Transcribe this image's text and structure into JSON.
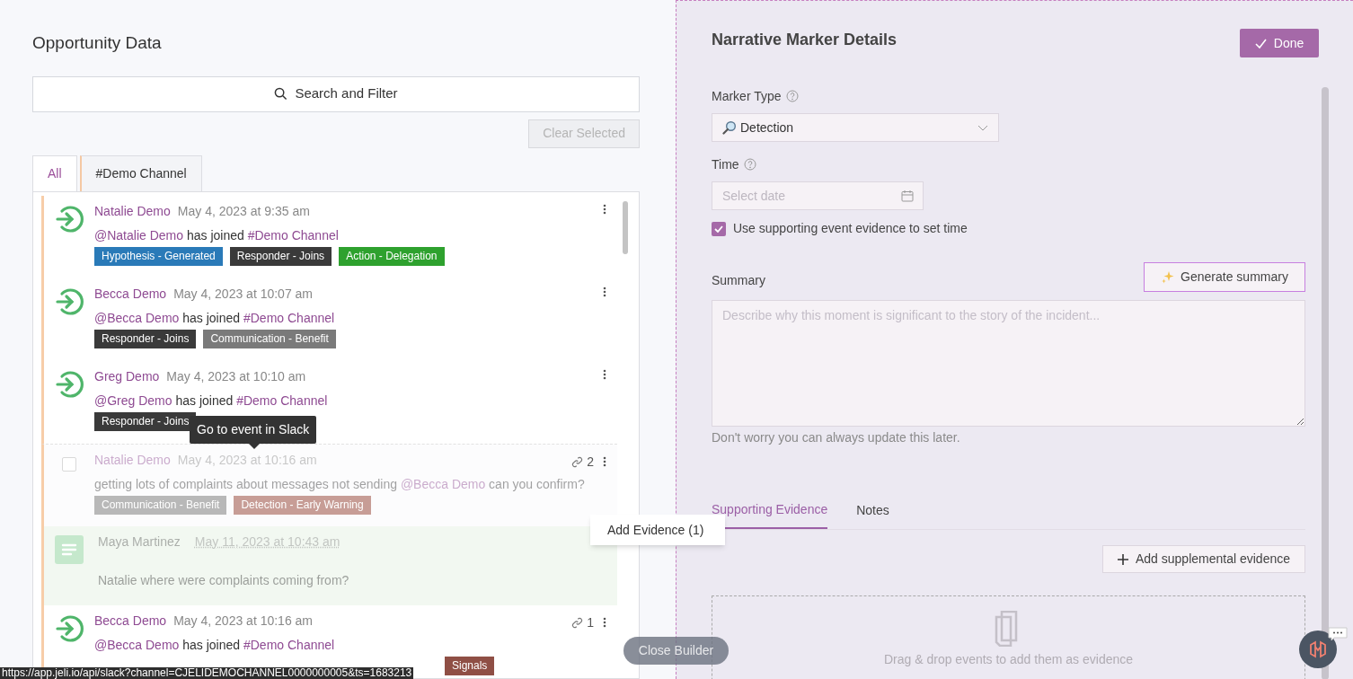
{
  "left": {
    "title": "Opportunity Data",
    "search_button": "Search and Filter",
    "clear_button": {
      "label": "Clear Selected",
      "disabled": true
    },
    "tabs": [
      {
        "label": "All",
        "selected": true
      },
      {
        "label": "#Demo Channel",
        "selected": false
      }
    ],
    "events": [
      {
        "kind": "join",
        "dimmed": false,
        "author": "Natalie Demo",
        "time": "May 4, 2023 at 9:35 am",
        "segments": [
          {
            "text": "@Natalie Demo",
            "mention": true
          },
          {
            "text": " has joined ",
            "mention": false
          },
          {
            "text": "#Demo Channel",
            "mention": true
          }
        ],
        "tags": [
          {
            "label": "Hypothesis - Generated",
            "color": "#2a7ab8"
          },
          {
            "label": "Responder - Joins",
            "color": "#3a3a3a"
          },
          {
            "label": "Action - Delegation",
            "color": "#2ea12e"
          }
        ]
      },
      {
        "kind": "join",
        "dimmed": false,
        "author": "Becca Demo",
        "time": "May 4, 2023 at 10:07 am",
        "segments": [
          {
            "text": "@Becca Demo",
            "mention": true
          },
          {
            "text": " has joined ",
            "mention": false
          },
          {
            "text": "#Demo Channel",
            "mention": true
          }
        ],
        "tags": [
          {
            "label": "Responder - Joins",
            "color": "#3a3a3a"
          },
          {
            "label": "Communication - Benefit",
            "color": "#7a7a7a"
          }
        ]
      },
      {
        "kind": "join",
        "dimmed": false,
        "author": "Greg Demo",
        "time": "May 4, 2023 at 10:10 am",
        "segments": [
          {
            "text": "@Greg Demo",
            "mention": true
          },
          {
            "text": " has joined ",
            "mention": false
          },
          {
            "text": "#Demo Channel",
            "mention": true
          }
        ],
        "tags": [
          {
            "label": "Responder - Joins",
            "color": "#3a3a3a"
          }
        ]
      },
      {
        "kind": "message",
        "dimmed": true,
        "checked": false,
        "author": "Natalie Demo",
        "time": "May 4, 2023 at 10:16 am",
        "link_count": "2",
        "segments": [
          {
            "text": "getting lots of complaints about messages not sending ",
            "mention": false
          },
          {
            "text": "@Becca Demo",
            "mention": true
          },
          {
            "text": " can you confirm?",
            "mention": false
          }
        ],
        "tags": [
          {
            "label": "Communication - Benefit",
            "color": "#b8b8b8"
          },
          {
            "label": "Detection - Early Warning",
            "color": "#c79d96"
          }
        ]
      },
      {
        "kind": "note",
        "dimmed": true,
        "author": "Maya Martinez",
        "time": "May 11, 2023 at 10:43 am",
        "segments": [
          {
            "text": "Natalie where were complaints coming from?",
            "mention": false
          }
        ]
      },
      {
        "kind": "join",
        "dimmed": false,
        "author": "Becca Demo",
        "time": "May 4, 2023 at 10:16 am",
        "link_count": "1",
        "segments": [
          {
            "text": "@Becca Demo",
            "mention": true
          },
          {
            "text": " has joined ",
            "mention": false
          },
          {
            "text": "#Demo Channel",
            "mention": true
          }
        ],
        "tags": [
          {
            "label": "Signals",
            "color": "#8f4f45"
          }
        ]
      }
    ]
  },
  "tooltip": "Go to event in Slack",
  "context_menu": {
    "item": "Add Evidence (1)"
  },
  "close_builder": "Close Builder",
  "status_url": "https://app.jeli.io/api/slack?channel=CJELIDEMOCHANNEL0000000005&ts=1683213",
  "right": {
    "title": "Narrative Marker Details",
    "done_button": "Done",
    "marker_type": {
      "label": "Marker Type",
      "value": "Detection"
    },
    "time": {
      "label": "Time",
      "placeholder": "Select date"
    },
    "evidence_time": {
      "label": "Use supporting event evidence to set time",
      "checked": true
    },
    "summary": {
      "label": "Summary",
      "generate_button": "Generate summary",
      "placeholder": "Describe why this moment is significant to the story of the incident...",
      "hint": "Don't worry you can always update this later."
    },
    "tabs": [
      {
        "label": "Supporting Evidence",
        "selected": true
      },
      {
        "label": "Notes",
        "selected": false
      }
    ],
    "add_button": "Add supplemental evidence",
    "dropzone": "Drag & drop events to add them as evidence"
  }
}
